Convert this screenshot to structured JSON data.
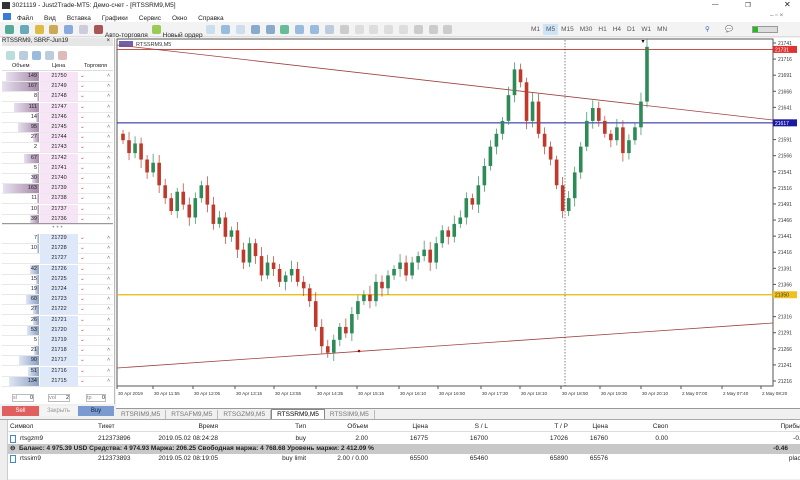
{
  "window": {
    "title": "3021119 - Just2Trade-MT5: Демо-счет - [RTSSRM9,M5]"
  },
  "menu": [
    "Файл",
    "Вид",
    "Вставка",
    "Графики",
    "Сервис",
    "Окно",
    "Справка"
  ],
  "toolbar": {
    "auto_trading": "Авто-торговля",
    "new_order": "Новый ордер",
    "timeframes": [
      "M1",
      "M5",
      "M15",
      "M30",
      "H1",
      "H4",
      "D1",
      "W1",
      "MN"
    ],
    "active_timeframe": "M5"
  },
  "depth": {
    "title": "RTSSRM9, SBRF-Jun19",
    "headers": [
      "Объем",
      "Цена",
      "Торговля"
    ],
    "asks": [
      [
        149,
        21750
      ],
      [
        167,
        21749
      ],
      [
        8,
        21748
      ],
      [
        111,
        21747
      ],
      [
        14,
        21746
      ],
      [
        95,
        21745
      ],
      [
        27,
        21744
      ],
      [
        2,
        21743
      ],
      [
        67,
        21742
      ],
      [
        5,
        21741
      ],
      [
        30,
        21740
      ],
      [
        163,
        21739
      ],
      [
        11,
        21738
      ],
      [
        10,
        21737
      ],
      [
        39,
        21736
      ]
    ],
    "separator": "• • •",
    "bids": [
      [
        7,
        21729
      ],
      [
        10,
        21728
      ],
      [
        "",
        21727
      ],
      [
        42,
        21726
      ],
      [
        15,
        21725
      ],
      [
        19,
        21724
      ],
      [
        60,
        21723
      ],
      [
        27,
        21722
      ],
      [
        26,
        21721
      ],
      [
        53,
        21720
      ],
      [
        5,
        21719
      ],
      [
        21,
        21718
      ],
      [
        90,
        21717
      ],
      [
        51,
        21716
      ],
      [
        134,
        21715
      ]
    ],
    "sl_label": "sl",
    "sl": "0",
    "vol_label": "vol",
    "vol": "2",
    "tp_label": "tp",
    "tp": "0",
    "sell": "Sell",
    "close": "Закрыть",
    "buy": "Buy"
  },
  "chart_tabs": [
    "RTSRIM9,M5",
    "RTSAFM9,M5",
    "RTSGZM9,M5",
    "RTSSRM9,M5",
    "RTSSIM9,M5"
  ],
  "active_chart_tab": "RTSSRM9,M5",
  "terminal": {
    "headers": [
      "Символ",
      "Тикет",
      "Время",
      "Тип",
      "Объем",
      "Цена",
      "S / L",
      "T / P",
      "Цена",
      "Своп",
      "Прибыль"
    ],
    "rows": [
      [
        "rtsgzm9",
        "212373896",
        "2019.05.02 08:24:28",
        "buy",
        "2.00",
        "16775",
        "16700",
        "17026",
        "16760",
        "0.00",
        "-0.46"
      ],
      [
        "rtssim9",
        "212373893",
        "2019.05.02 08:19:05",
        "buy limit",
        "2.00 / 0.00",
        "65500",
        "65460",
        "65890",
        "65576",
        "",
        "placed"
      ]
    ],
    "balance": "Баланс: 4 975.39 USD  Средства: 4 974.93  Маржа: 206.25  Свободная маржа: 4 768.68  Уровень маржи: 2 412.09 %",
    "balance_profit": "-0.46"
  },
  "chart_data": {
    "type": "candlestick",
    "symbol": "RTSSRM9,M5",
    "y_ticks": [
      21741,
      21716,
      21691,
      21666,
      21641,
      21591,
      21566,
      21541,
      21516,
      21491,
      21466,
      21441,
      21416,
      21391,
      21366,
      21316,
      21291,
      21266,
      21241,
      21216
    ],
    "ylim": [
      21206,
      21750
    ],
    "price_labels": {
      "ask": "21731",
      "current": "21617",
      "level": "21350"
    },
    "x_ticks": [
      "30 Apr 2019",
      "30 Apr 11:55",
      "30 Apr 12:05",
      "30 Apr 13:15",
      "30 Apr 13:55",
      "30 Apr 14:35",
      "30 Apr 15:15",
      "30 Apr 16:10",
      "30 Apr 16:50",
      "30 Apr 17:30",
      "30 Apr 18:10",
      "30 Apr 18:50",
      "30 Apr 19:30",
      "30 Apr 20:10",
      "2 May 07:00",
      "2 May 07:40",
      "2 May 08:20"
    ],
    "closes": [
      21590,
      21570,
      21585,
      21560,
      21540,
      21555,
      21520,
      21500,
      21480,
      21510,
      21490,
      21470,
      21500,
      21520,
      21490,
      21460,
      21470,
      21440,
      21450,
      21420,
      21400,
      21430,
      21410,
      21380,
      21400,
      21390,
      21370,
      21380,
      21390,
      21370,
      21360,
      21340,
      21300,
      21270,
      21260,
      21280,
      21300,
      21290,
      21320,
      21340,
      21350,
      21340,
      21370,
      21360,
      21380,
      21390,
      21400,
      21380,
      21400,
      21410,
      21420,
      21400,
      21430,
      21450,
      21440,
      21460,
      21470,
      21500,
      21490,
      21520,
      21550,
      21580,
      21600,
      21620,
      21660,
      21700,
      21680,
      21620,
      21650,
      21600,
      21580,
      21560,
      21520,
      21480,
      21500,
      21540,
      21580,
      21620,
      21640,
      21620,
      21600,
      21590,
      21610,
      21570,
      21590,
      21610,
      21650,
      21735
    ],
    "colors": {
      "up": "#2e8b57",
      "down": "#c0392b",
      "ask_line": "#c0392b",
      "bid_line": "#1a1aa0",
      "level_line": "#e6b800",
      "trend": "#a04040"
    }
  }
}
